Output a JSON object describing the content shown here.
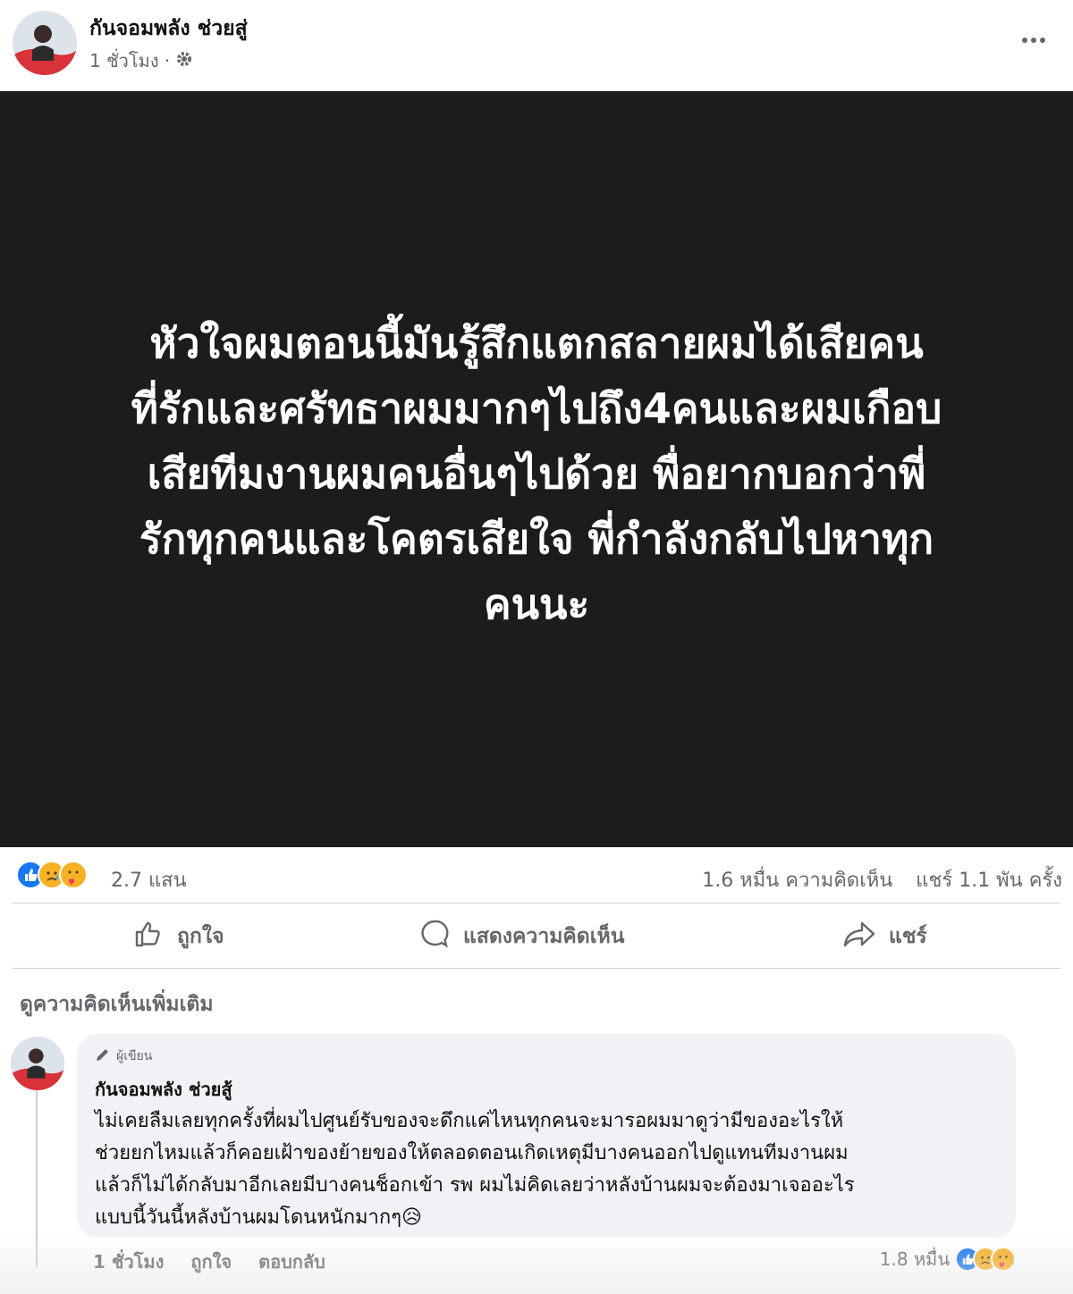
{
  "post": {
    "author": "กันจอมพลัง ช่วยสู่",
    "time": "1 ชั่วโมง ·",
    "text": "หัวใจผมตอนนี้มันรู้สึกแตกสลายผมได้เสียคน\nที่รักและศรัทธาผมมากๆไปถึง4คนและผมเกือบ\nเสียทีมงานผมคนอื่นๆไปด้วย พื่อยากบอกว่าพี่\nรักทุกคนและโคตรเสียใจ พี่กำลังกลับไปหาทุก\nคนนะ"
  },
  "stats": {
    "reaction_count": "2.7 แสน",
    "comments": "1.6 หมื่น ความคิดเห็น",
    "shares": "แชร์ 1.1 พัน ครั้ง",
    "reaction_icons": [
      "like-icon",
      "sad-icon",
      "care-icon"
    ]
  },
  "actions": {
    "like": "ถูกใจ",
    "comment": "แสดงความคิดเห็น",
    "share": "แชร์"
  },
  "more_comments": "ดูความคิดเห็นเพิ่มเติม",
  "comment": {
    "badge": "ผู้เขียน",
    "author": "กันจอมพลัง ช่วยสู้",
    "text": "ไม่เคยลืมเลยทุกครั้งที่ผมไปศูนย์รับของจะดึกแค่ไหนทุกคนจะมารอผมมาดูว่ามีของอะไรให้\nช่วยยกไหมแล้วก็คอยเฝ้าของย้ายของให้ตลอดตอนเกิดเหตุมีบางคนออกไปดูแทนทีมงานผม\nแล้วก็ไม่ได้กลับมาอีกเลยมีบางคนช็อกเข้า รพ ผมไม่คิดเลยว่าหลังบ้านผมจะต้องมาเจออะไร\nแบบนี้วันนี้หลังบ้านผมโดนหนักมากๆ😥",
    "time": "1 ชั่วโมง",
    "like": "ถูกใจ",
    "reply": "ตอบกลับ",
    "reaction_count": "1.8 หมื่น"
  },
  "colors": {
    "post_background": "#1c1c1c",
    "like_blue": "#1877f2",
    "muted_text": "#65676b"
  }
}
